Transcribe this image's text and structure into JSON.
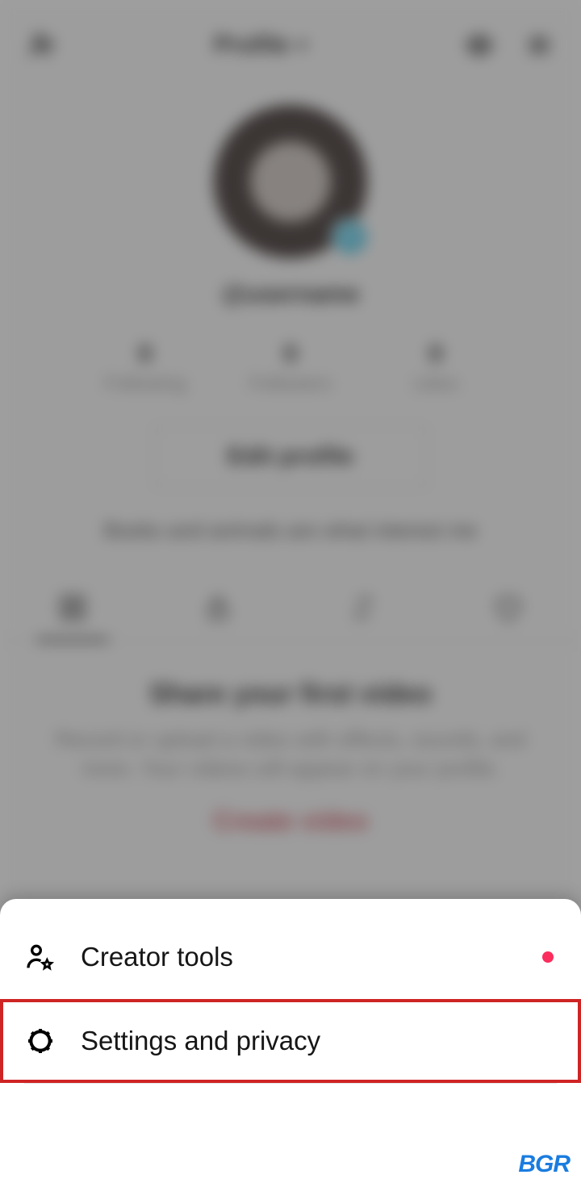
{
  "header": {
    "title": "Profile",
    "username_dropdown": "▾"
  },
  "profile": {
    "handle": "@username",
    "avatar_badge": "+",
    "stats": [
      {
        "num": "0",
        "lbl": "Following"
      },
      {
        "num": "0",
        "lbl": "Followers"
      },
      {
        "num": "0",
        "lbl": "Likes"
      }
    ],
    "edit_label": "Edit profile",
    "bio": "Books and animals are what interest me"
  },
  "empty": {
    "heading": "Share your first video",
    "body": "Record or upload a video with effects, sounds, and more. Your videos will appear on your profile.",
    "cta": "Create video"
  },
  "sheet": {
    "items": [
      {
        "label": "Creator tools",
        "has_dot": true
      },
      {
        "label": "Settings and privacy",
        "has_dot": false,
        "highlighted": true
      }
    ]
  },
  "watermark": "BGR"
}
